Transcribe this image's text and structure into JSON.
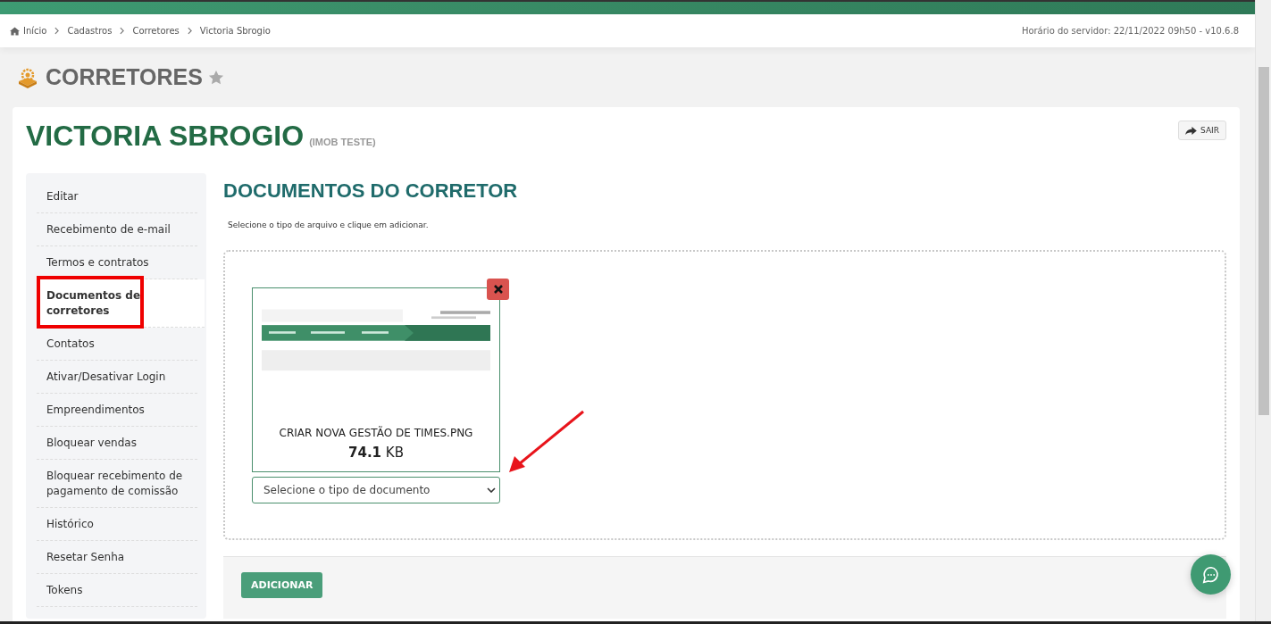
{
  "breadcrumb": {
    "items": [
      "Início",
      "Cadastros",
      "Corretores",
      "Victoria Sbrogio"
    ],
    "server_time": "Horário do servidor: 22/11/2022 09h50 - v10.6.8"
  },
  "page": {
    "title": "CORRETORES",
    "favorite": false
  },
  "broker": {
    "name": "VICTORIA SBROGIO",
    "agency": "(IMOB TESTE)",
    "exit_button": "SAIR"
  },
  "sidebar": {
    "items": [
      {
        "label": "Editar",
        "selected": false,
        "highlighted": false
      },
      {
        "label": "Recebimento de e-mail",
        "selected": false,
        "highlighted": false
      },
      {
        "label": "Termos e contratos",
        "selected": false,
        "highlighted": false
      },
      {
        "label": "Documentos de corretores",
        "selected": true,
        "highlighted": true
      },
      {
        "label": "Contatos",
        "selected": false,
        "highlighted": false
      },
      {
        "label": "Ativar/Desativar Login",
        "selected": false,
        "highlighted": false
      },
      {
        "label": "Empreendimentos",
        "selected": false,
        "highlighted": false
      },
      {
        "label": "Bloquear vendas",
        "selected": false,
        "highlighted": false
      },
      {
        "label": "Bloquear recebimento de pagamento de comissão",
        "selected": false,
        "highlighted": false
      },
      {
        "label": "Histórico",
        "selected": false,
        "highlighted": false
      },
      {
        "label": "Resetar Senha",
        "selected": false,
        "highlighted": false
      },
      {
        "label": "Tokens",
        "selected": false,
        "highlighted": false
      }
    ]
  },
  "documents": {
    "title": "DOCUMENTOS DO CORRETOR",
    "instruction": "Selecione o tipo de arquivo e clique em adicionar.",
    "files": [
      {
        "kind": "picture",
        "name": "CRIAR NOVA GESTÃO DE TIMES.PNG",
        "size": "74.1",
        "unit": "KB",
        "type_placeholder": "Selecione o tipo de documento"
      }
    ],
    "add_button": "ADICIONAR"
  }
}
